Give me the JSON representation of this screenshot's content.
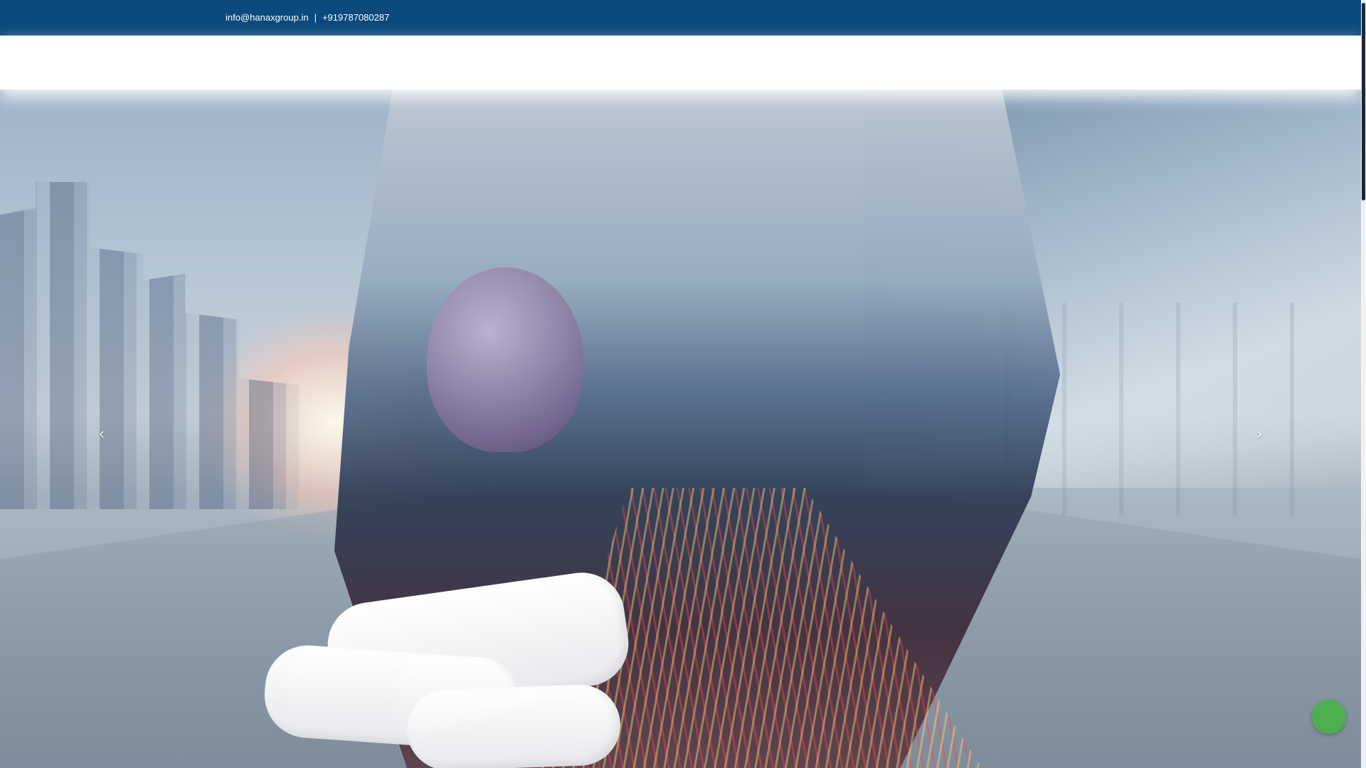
{
  "topbar": {
    "email": "info@hanaxgroup.in",
    "separator": "|",
    "phone": "+919787080287"
  },
  "slider": {
    "prev_arrow": "‹",
    "next_arrow": "›"
  },
  "icons": {
    "prev": "chevron-left-icon",
    "next": "chevron-right-icon"
  },
  "colors": {
    "topbar_bg": "#0a4a7c",
    "float_button": "#4caf50",
    "scroll_thumb": "#1f2733"
  }
}
